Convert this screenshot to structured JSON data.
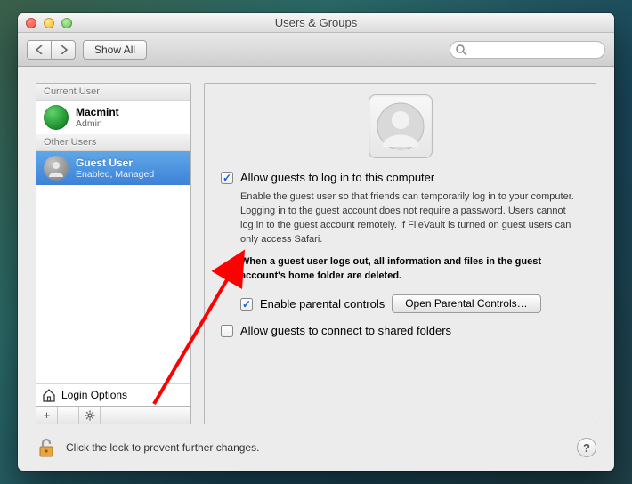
{
  "window_title": "Users & Groups",
  "toolbar": {
    "show_all": "Show All",
    "search_placeholder": ""
  },
  "sidebar": {
    "current_user_header": "Current User",
    "other_users_header": "Other Users",
    "current_user": {
      "name": "Macmint",
      "role": "Admin"
    },
    "guest_user": {
      "name": "Guest User",
      "status": "Enabled, Managed"
    },
    "login_options": "Login Options"
  },
  "main": {
    "allow_login_label": "Allow guests to log in to this computer",
    "allow_login_desc": "Enable the guest user so that friends can temporarily log in to your computer. Logging in to the guest account does not require a password. Users cannot log in to the guest account remotely. If FileVault is turned on guest users can only access Safari.",
    "allow_login_warning": "When a guest user logs out, all information and files in the guest account's home folder are deleted.",
    "parental_label": "Enable parental controls",
    "parental_button": "Open Parental Controls…",
    "shared_folders_label": "Allow guests to connect to shared folders"
  },
  "footer": {
    "lock_text": "Click the lock to prevent further changes."
  }
}
